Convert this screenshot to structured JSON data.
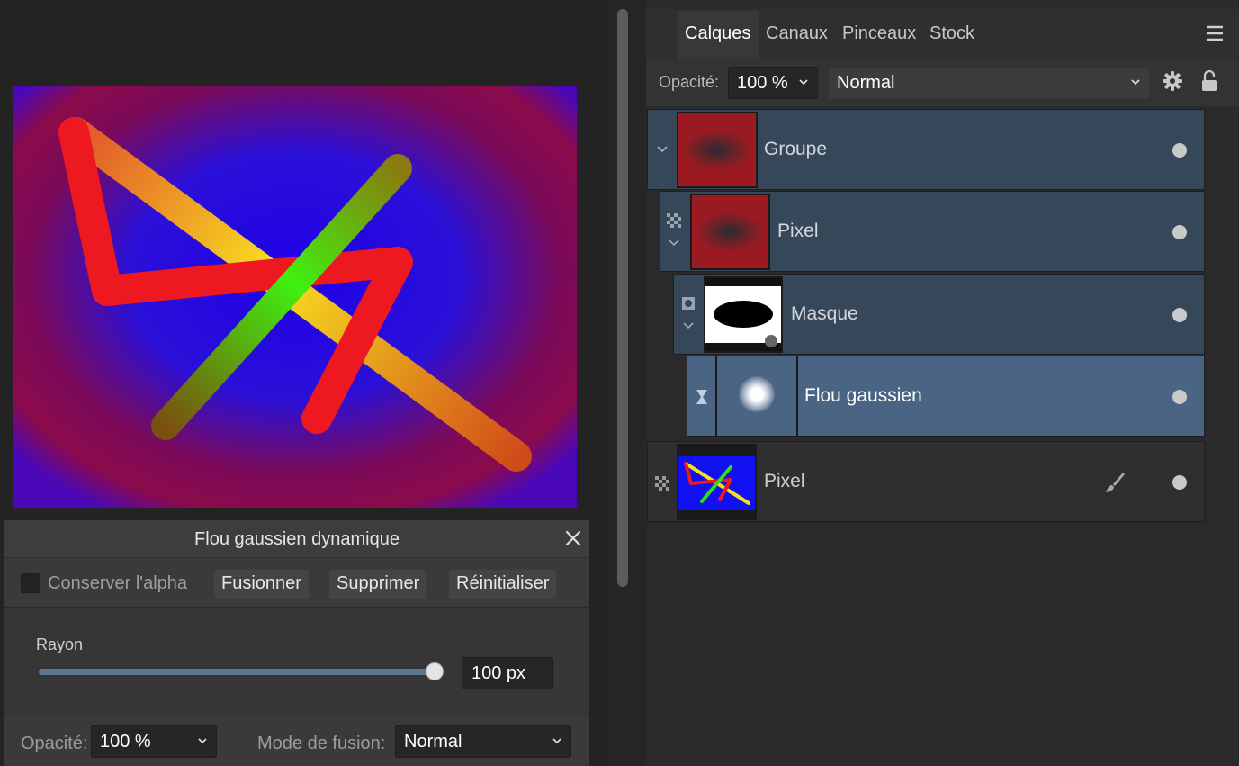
{
  "filter_dialog": {
    "title": "Flou gaussien dynamique",
    "preserve_alpha_label": "Conserver l'alpha",
    "preserve_alpha_checked": false,
    "merge_label": "Fusionner",
    "delete_label": "Supprimer",
    "reset_label": "Réinitialiser",
    "radius_label": "Rayon",
    "radius_value": "100 px",
    "radius_slider_fraction": 1.0,
    "opacity_label": "Opacité:",
    "opacity_value": "100 %",
    "blend_mode_label": "Mode de fusion:",
    "blend_mode_value": "Normal"
  },
  "layers_panel": {
    "tabs": [
      "Calques",
      "Canaux",
      "Pinceaux",
      "Stock"
    ],
    "active_tab": "Calques",
    "opacity_label": "Opacité:",
    "opacity_value": "100 %",
    "blend_mode_value": "Normal",
    "layers": [
      {
        "name": "Groupe",
        "indent": 0,
        "selected": false
      },
      {
        "name": "Pixel",
        "indent": 1,
        "selected": false
      },
      {
        "name": "Masque",
        "indent": 2,
        "selected": false
      },
      {
        "name": "Flou gaussien",
        "indent": 3,
        "selected": true
      },
      {
        "name": "Pixel",
        "indent": 0,
        "selected": false
      }
    ]
  },
  "colors": {
    "accent_selected_row": "#4a6584",
    "group_row": "#37475a",
    "slider_track": "#5e7590"
  },
  "icons": [
    "close-icon",
    "hamburger-menu-icon",
    "gear-icon",
    "lock-icon",
    "chevron-down-icon",
    "checker-icon",
    "mask-icon",
    "filter-hourglass-icon",
    "brush-icon"
  ]
}
